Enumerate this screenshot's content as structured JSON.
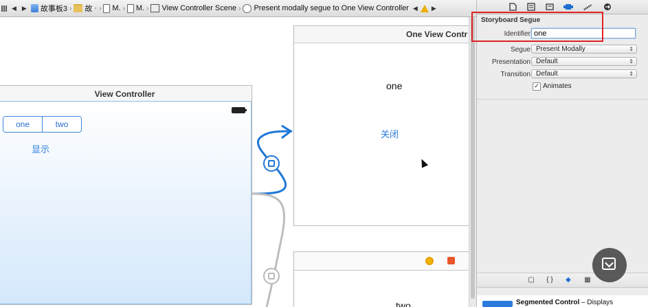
{
  "jumpbar": {
    "items": [
      {
        "label": "故事板3",
        "icon": "storyboard-icon"
      },
      {
        "label": "故",
        "icon": "folder-icon"
      },
      {
        "label": "M.",
        "icon": "file-icon"
      },
      {
        "label": "M.",
        "icon": "file-icon"
      },
      {
        "label": "View Controller Scene",
        "icon": "scene-icon"
      },
      {
        "label": "Present modally segue to One View Controller",
        "icon": "segue-icon"
      }
    ],
    "separator": "›",
    "back_glyph": "◀",
    "forward_glyph": "▶",
    "overflow_glyph": "·"
  },
  "canvas": {
    "view_controller": {
      "title": "View Controller",
      "segment_one": "one",
      "segment_two": "two",
      "show_button": "显示"
    },
    "one_view_controller": {
      "title": "One View Contr",
      "label": "one",
      "close_button": "关闭"
    },
    "two_view_controller": {
      "label": "two"
    }
  },
  "inspector": {
    "tab_icons": [
      "file-icon",
      "quick-help-icon",
      "identity-icon",
      "attributes-icon",
      "size-icon",
      "connections-icon"
    ],
    "section_title": "Storyboard Segue",
    "identifier_label": "Identifier",
    "identifier_value": "one",
    "segue_label": "Segue",
    "segue_value": "Present Modally",
    "presentation_label": "Presentation",
    "presentation_value": "Default",
    "transition_label": "Transition",
    "transition_value": "Default",
    "animates_label": "Animates",
    "animates_checked": true,
    "popup_arrows": "⇕",
    "check_glyph": "✓",
    "library_icons": [
      "file-template-icon",
      "code-snippet-icon",
      "object-icon",
      "media-icon"
    ],
    "library_glyphs": [
      "▢",
      "{ }",
      "◆",
      "▦"
    ],
    "library_item_title": "Segmented Control",
    "library_item_desc": " – Displays"
  },
  "colors": {
    "accent": "#2a7bdc",
    "segue_line": "#1f77d6",
    "highlight_box": "#e02020"
  }
}
